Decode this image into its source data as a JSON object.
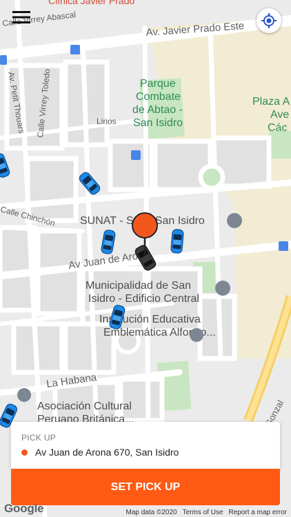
{
  "header": {
    "menu_icon": "hamburger-menu-icon",
    "locate_icon": "my-location-icon",
    "top_label": "Clínica Javier Prado"
  },
  "map": {
    "streets": {
      "javier_prado": "Av. Javier Prado Este",
      "virrey_abascal": "Calle Virrey Abascal",
      "petit_thouars": "Av. Petit Thouars",
      "virrey_toledo": "Calle Virrey Toledo",
      "lirios": "Lirios",
      "chinchon": "Calle Chinchón",
      "juan_de_arona": "Av Juan de Arona",
      "la_habana": "La Habana",
      "gonzales": "Gonzal"
    },
    "places": {
      "park_line1": "Parque",
      "park_line2": "Combate",
      "park_line3": "de Abtao -",
      "park_line4": "San Isidro",
      "plaza_line1": "Plaza A",
      "plaza_line2": "Ave",
      "plaza_line3": "Các",
      "sunat": "SUNAT - Sede San Isidro",
      "muni_line1": "Municipalidad de San",
      "muni_line2": "Isidro - Edificio Central",
      "school_line1": "Institución Educativa",
      "school_line2": "Emblemática Alfonso...",
      "asoc_line1": "Asociación Cultural",
      "asoc_line2": "Peruano Británica..."
    },
    "colors": {
      "accent": "#ff5a14",
      "pin": "#f2581e",
      "taxi": "#1e88e5",
      "park": "#c8e6c1"
    }
  },
  "pickup": {
    "label": "PICK UP",
    "address": "Av Juan de Arona 670, San Isidro"
  },
  "actions": {
    "set_pickup": "SET PICK UP"
  },
  "footer": {
    "logo": "Google",
    "map_data": "Map data ©2020",
    "terms": "Terms of Use",
    "report": "Report a map error"
  }
}
